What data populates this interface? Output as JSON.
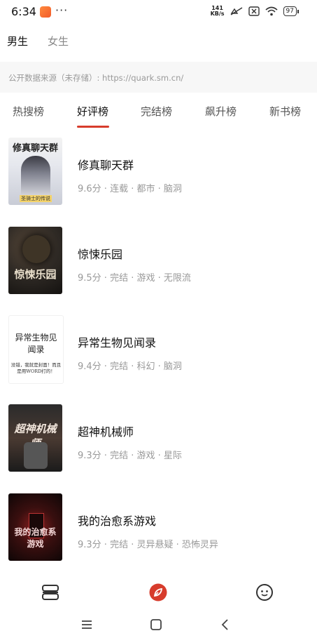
{
  "status_bar": {
    "time": "6:34",
    "dots": "···",
    "net_speed_value": "141",
    "net_speed_unit": "KB/s",
    "battery": "97"
  },
  "gender_tabs": [
    {
      "label": "男生",
      "active": true
    },
    {
      "label": "女生",
      "active": false
    }
  ],
  "source_note": "公开数据来源（未存储）: https://quark.sm.cn/",
  "rank_tabs": [
    {
      "label": "热搜榜",
      "active": false
    },
    {
      "label": "好评榜",
      "active": true
    },
    {
      "label": "完结榜",
      "active": false
    },
    {
      "label": "飙升榜",
      "active": false
    },
    {
      "label": "新书榜",
      "active": false
    }
  ],
  "books": [
    {
      "title": "修真聊天群",
      "meta": "9.6分 · 连载 · 都市 · 脑洞",
      "cover_title": "修真聊天群",
      "cover_foot": "圣骑士的传说"
    },
    {
      "title": "惊悚乐园",
      "meta": "9.5分 · 完结 · 游戏 · 无限流",
      "cover_title": "惊悚乐园"
    },
    {
      "title": "异常生物见闻录",
      "meta": "9.4分 · 完结 · 科幻 · 脑洞",
      "cover_title": "异常生物见闻录",
      "cover_sub": "没错，我就是封面！而且是用WORD打的！"
    },
    {
      "title": "超神机械师",
      "meta": "9.3分 · 完结 · 游戏 · 星际",
      "cover_title": "超神机械师"
    },
    {
      "title": "我的治愈系游戏",
      "meta": "9.3分 · 完结 · 灵异悬疑 · 恐怖灵异",
      "cover_title": "我的治愈系游戏"
    }
  ],
  "colors": {
    "accent": "#d73c2c",
    "text_primary": "#111111",
    "text_secondary": "#999999"
  },
  "bottom_nav": [
    {
      "icon": "bookshelf-icon"
    },
    {
      "icon": "discover-compass-icon",
      "active": true
    },
    {
      "icon": "profile-face-icon"
    }
  ],
  "system_nav": [
    {
      "icon": "menu-icon"
    },
    {
      "icon": "home-square-icon"
    },
    {
      "icon": "back-icon"
    }
  ]
}
